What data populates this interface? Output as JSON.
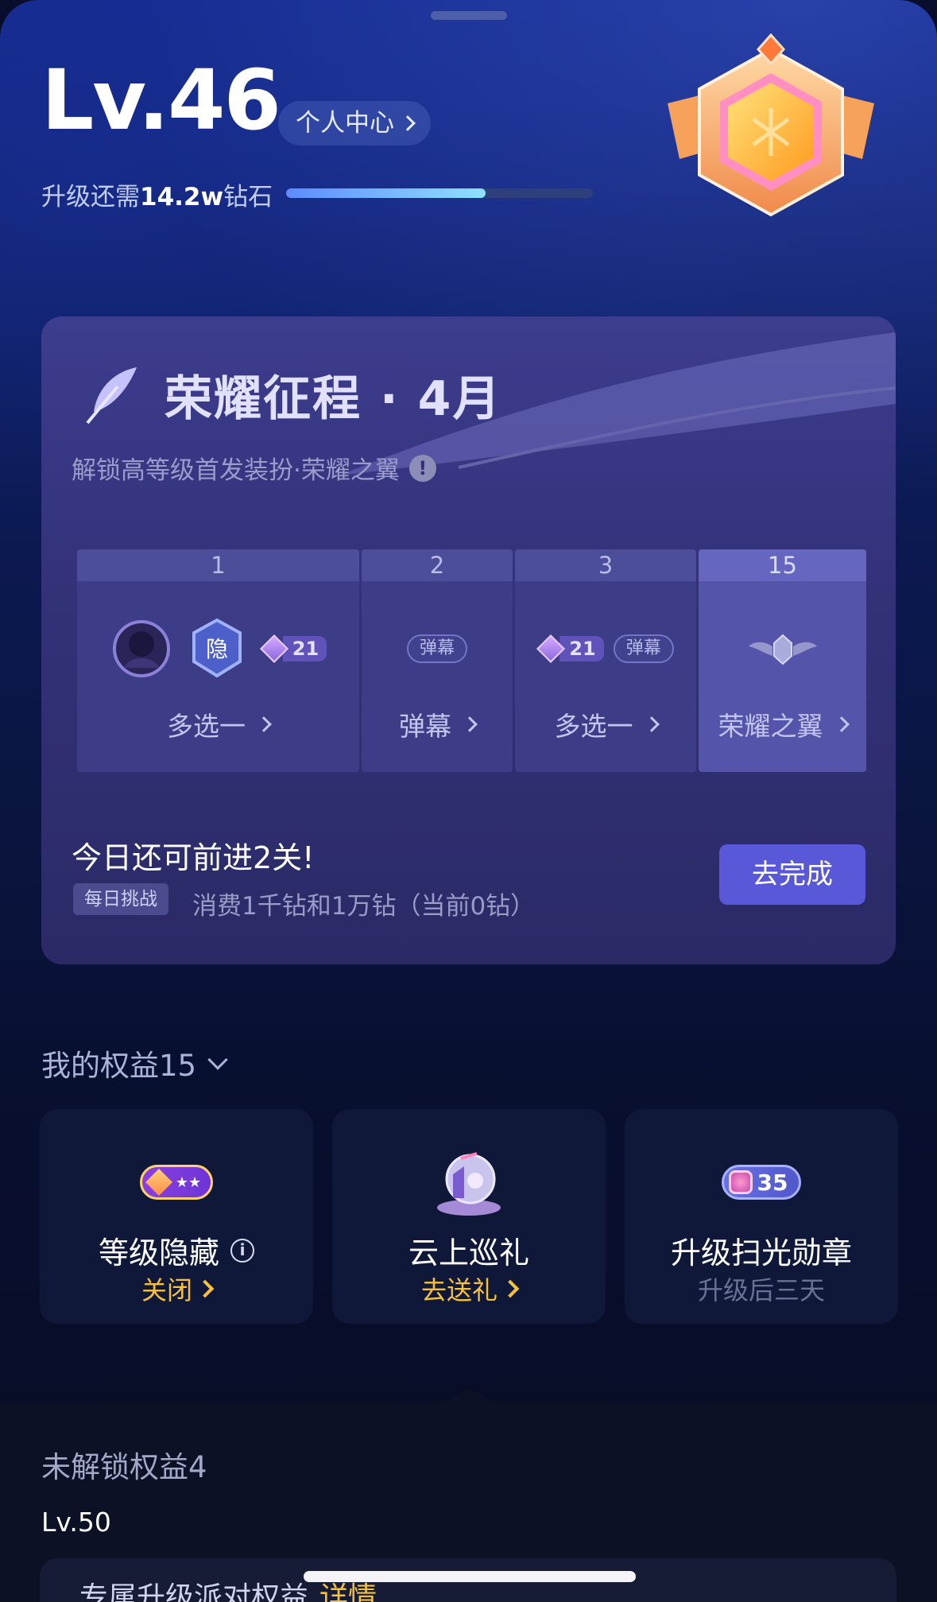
{
  "header": {
    "level": "Lv.46",
    "personal_center": "个人中心",
    "upgrade_prefix": "升级还需",
    "upgrade_amount": "14.2w",
    "upgrade_suffix": "钻石",
    "progress": 0.65
  },
  "glory": {
    "title": "荣耀征程 · 4月",
    "subtitle": "解锁高等级首发装扮·荣耀之翼",
    "info_icon": "!",
    "steps": [
      {
        "num": "1",
        "label": "多选一",
        "gem": "21"
      },
      {
        "num": "2",
        "label": "弹幕",
        "chip": "弹幕"
      },
      {
        "num": "3",
        "label": "多选一",
        "gem": "21",
        "chip": "弹幕"
      },
      {
        "num": "15",
        "label": "荣耀之翼"
      }
    ],
    "today_text": "今日还可前进2关!",
    "tag": "每日挑战",
    "spend_text": "消费1千钻和1万钻（当前0钻）",
    "action_button": "去完成"
  },
  "rights": {
    "title": "我的权益15",
    "items": [
      {
        "title": "等级隐藏",
        "sub": "关闭",
        "icon": "level-hide-icon"
      },
      {
        "title": "云上巡礼",
        "sub": "去送礼",
        "icon": "cloud-parade-icon"
      },
      {
        "title": "升级扫光勋章",
        "sub": "升级后三天",
        "pill": "35",
        "icon": "shine-medal-icon"
      }
    ]
  },
  "locked": {
    "title": "未解锁权益4",
    "level": "Lv.50",
    "item_text": "专属升级派对权益",
    "detail": "详情"
  },
  "colors": {
    "accent_button": "#5958d8",
    "gold": "#f7c23a",
    "background": "#0a1540"
  }
}
